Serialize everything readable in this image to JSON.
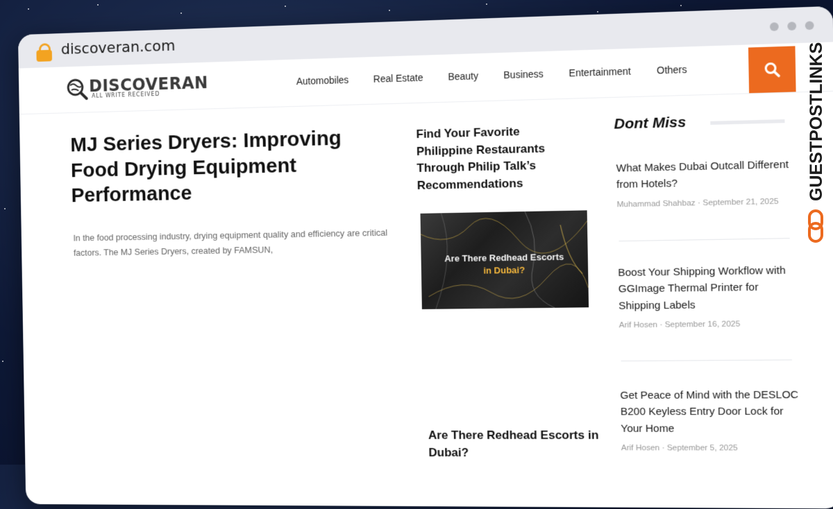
{
  "browser": {
    "url": "discoveran.com"
  },
  "site": {
    "logo_text": "DISCOVERAN",
    "logo_tagline": "ALL WRITE RECEIVED",
    "nav": [
      "Automobiles",
      "Real Estate",
      "Beauty",
      "Business",
      "Entertainment",
      "Others"
    ],
    "accent_color": "#ec6a1f"
  },
  "hero": {
    "title": "MJ Series Dryers: Improving Food Drying Equipment Performance",
    "excerpt": "In the food processing industry, drying equipment quality and efficiency are critical factors. The MJ Series Dryers, created by FAMSUN,"
  },
  "middle": {
    "article1_title": "Find Your Favorite Philippine Restaurants Through Philip Talk’s Recommendations",
    "thumb_line1": "Are There Redhead Escorts",
    "thumb_line2": "in Dubai?",
    "article2_title": "Are There Redhead Escorts in Dubai?"
  },
  "dont_miss": {
    "heading": "Dont Miss",
    "items": [
      {
        "title": "What Makes Dubai Outcall Different from Hotels?",
        "author": "Muhammad Shahbaz",
        "date": "September 21, 2025"
      },
      {
        "title": "Boost Your Shipping Workflow with GGImage Thermal Printer for Shipping Labels",
        "author": "Arif Hosen",
        "date": "September 16, 2025"
      },
      {
        "title": "Get Peace of Mind with the DESLOC B200 Keyless Entry Door Lock for Your Home",
        "author": "Arif Hosen",
        "date": "September 5, 2025"
      }
    ],
    "separator": " · "
  },
  "watermark": {
    "text": "GUESTPOSTLINKS"
  }
}
